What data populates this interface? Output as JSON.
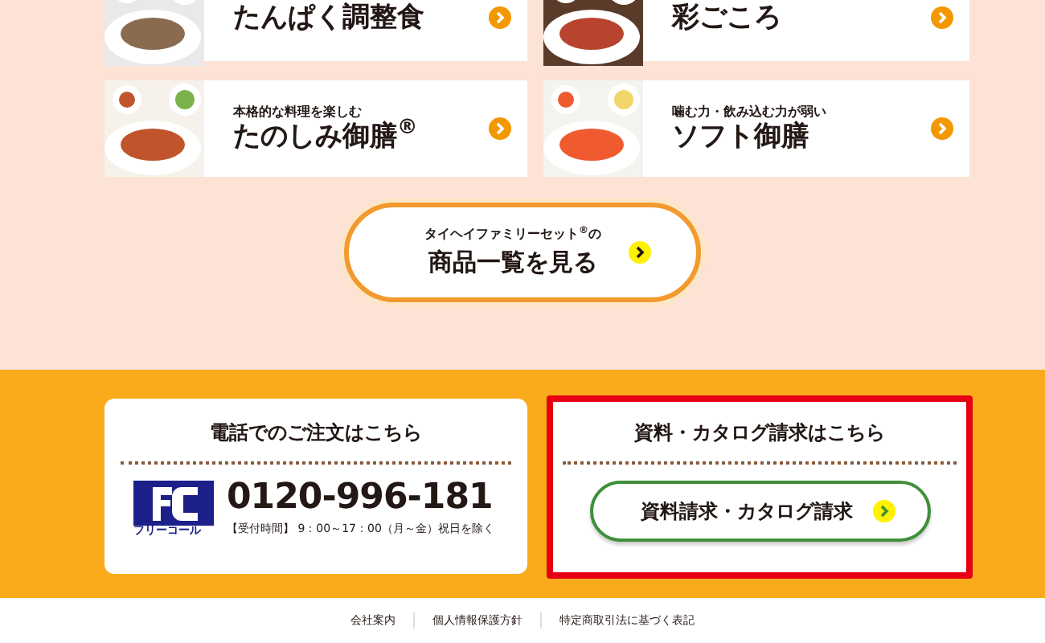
{
  "products": [
    {
      "title": "たんぱく調整食",
      "kind": "picture"
    },
    {
      "title": "彩ごころ",
      "kind": "picture"
    },
    {
      "subtitle": "本格的な料理を楽しむ",
      "title": "たのしみ御膳$^{®}$",
      "kind": "picture"
    },
    {
      "subtitle": "噛む力・飲み込む力が弱い",
      "title": "ソフト御膳",
      "kind": "picture"
    }
  ],
  "list_button": {
    "sub": "タイヘイファミリーセット$^{®}$の",
    "label": "商品一覧を見る"
  },
  "phone_card": {
    "title": "電話でのご注文はこちら",
    "logo_text": "フリーコール",
    "number": "0120-996-181",
    "hours": "【受付時間】 9：00～17：00（月～金）祝日を除く",
    "highlighted": false
  },
  "catalog_card": {
    "title": "資料・カタログ請求はこちら",
    "button": "資料請求・カタログ請求",
    "highlighted": true
  },
  "footer_links": [
    "会社案内",
    "個人情報保護方針",
    "特定商取引法に基づく表記"
  ]
}
